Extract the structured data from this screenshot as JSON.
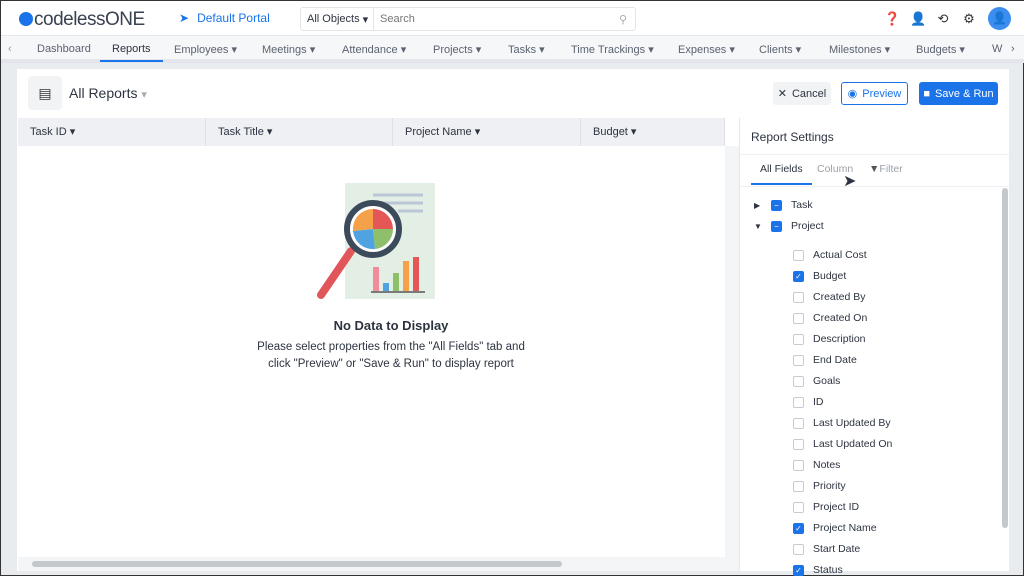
{
  "app": {
    "logo": "codelessONE",
    "portal": "Default Portal"
  },
  "search": {
    "scope": "All Objects",
    "placeholder": "Search"
  },
  "nav": [
    "Dashboard",
    "Reports",
    "Employees",
    "Meetings",
    "Attendance",
    "Projects",
    "Tasks",
    "Time Trackings",
    "Expenses",
    "Clients",
    "Milestones",
    "Budgets",
    "W"
  ],
  "nav_active": "Reports",
  "report": {
    "title": "All Reports",
    "cancel": "Cancel",
    "preview": "Preview",
    "save": "Save & Run"
  },
  "columns": [
    "Task ID",
    "Task Title",
    "Project Name",
    "Budget"
  ],
  "empty": {
    "title": "No Data to Display",
    "line1": "Please select properties from the \"All Fields\" tab and",
    "line2": "click \"Preview\" or \"Save & Run\" to display report"
  },
  "settings": {
    "title": "Report Settings",
    "tabs": [
      "All Fields",
      "Column",
      "Filter"
    ],
    "active_tab": "All Fields",
    "groups": [
      {
        "label": "Task",
        "expanded": false,
        "state": "partial"
      },
      {
        "label": "Project",
        "expanded": true,
        "state": "partial"
      }
    ],
    "fields": [
      {
        "label": "Actual Cost",
        "checked": false
      },
      {
        "label": "Budget",
        "checked": true
      },
      {
        "label": "Created By",
        "checked": false
      },
      {
        "label": "Created On",
        "checked": false
      },
      {
        "label": "Description",
        "checked": false
      },
      {
        "label": "End Date",
        "checked": false
      },
      {
        "label": "Goals",
        "checked": false
      },
      {
        "label": "ID",
        "checked": false
      },
      {
        "label": "Last Updated By",
        "checked": false
      },
      {
        "label": "Last Updated On",
        "checked": false
      },
      {
        "label": "Notes",
        "checked": false
      },
      {
        "label": "Priority",
        "checked": false
      },
      {
        "label": "Project ID",
        "checked": false
      },
      {
        "label": "Project Name",
        "checked": true
      },
      {
        "label": "Start Date",
        "checked": false
      },
      {
        "label": "Status",
        "checked": true
      }
    ]
  },
  "colors": {
    "accent": "#1a73e8"
  }
}
